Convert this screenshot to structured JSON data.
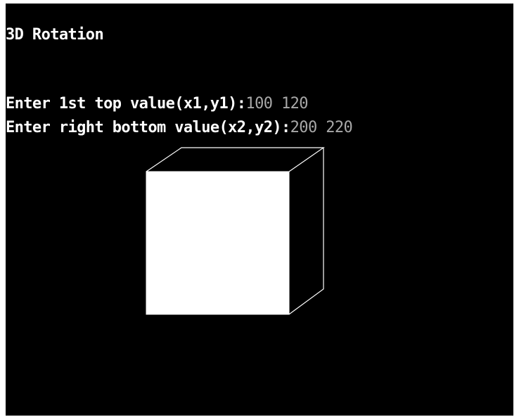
{
  "title": "3D Rotation",
  "prompts": [
    {
      "label": "Enter 1st top value(x1,y1):",
      "value": "100 120"
    },
    {
      "label": "Enter right bottom value(x2,y2):",
      "value": "200 220"
    }
  ],
  "colors": {
    "background": "#000000",
    "foreground": "#ffffff",
    "input_text": "#a8a8a8"
  }
}
